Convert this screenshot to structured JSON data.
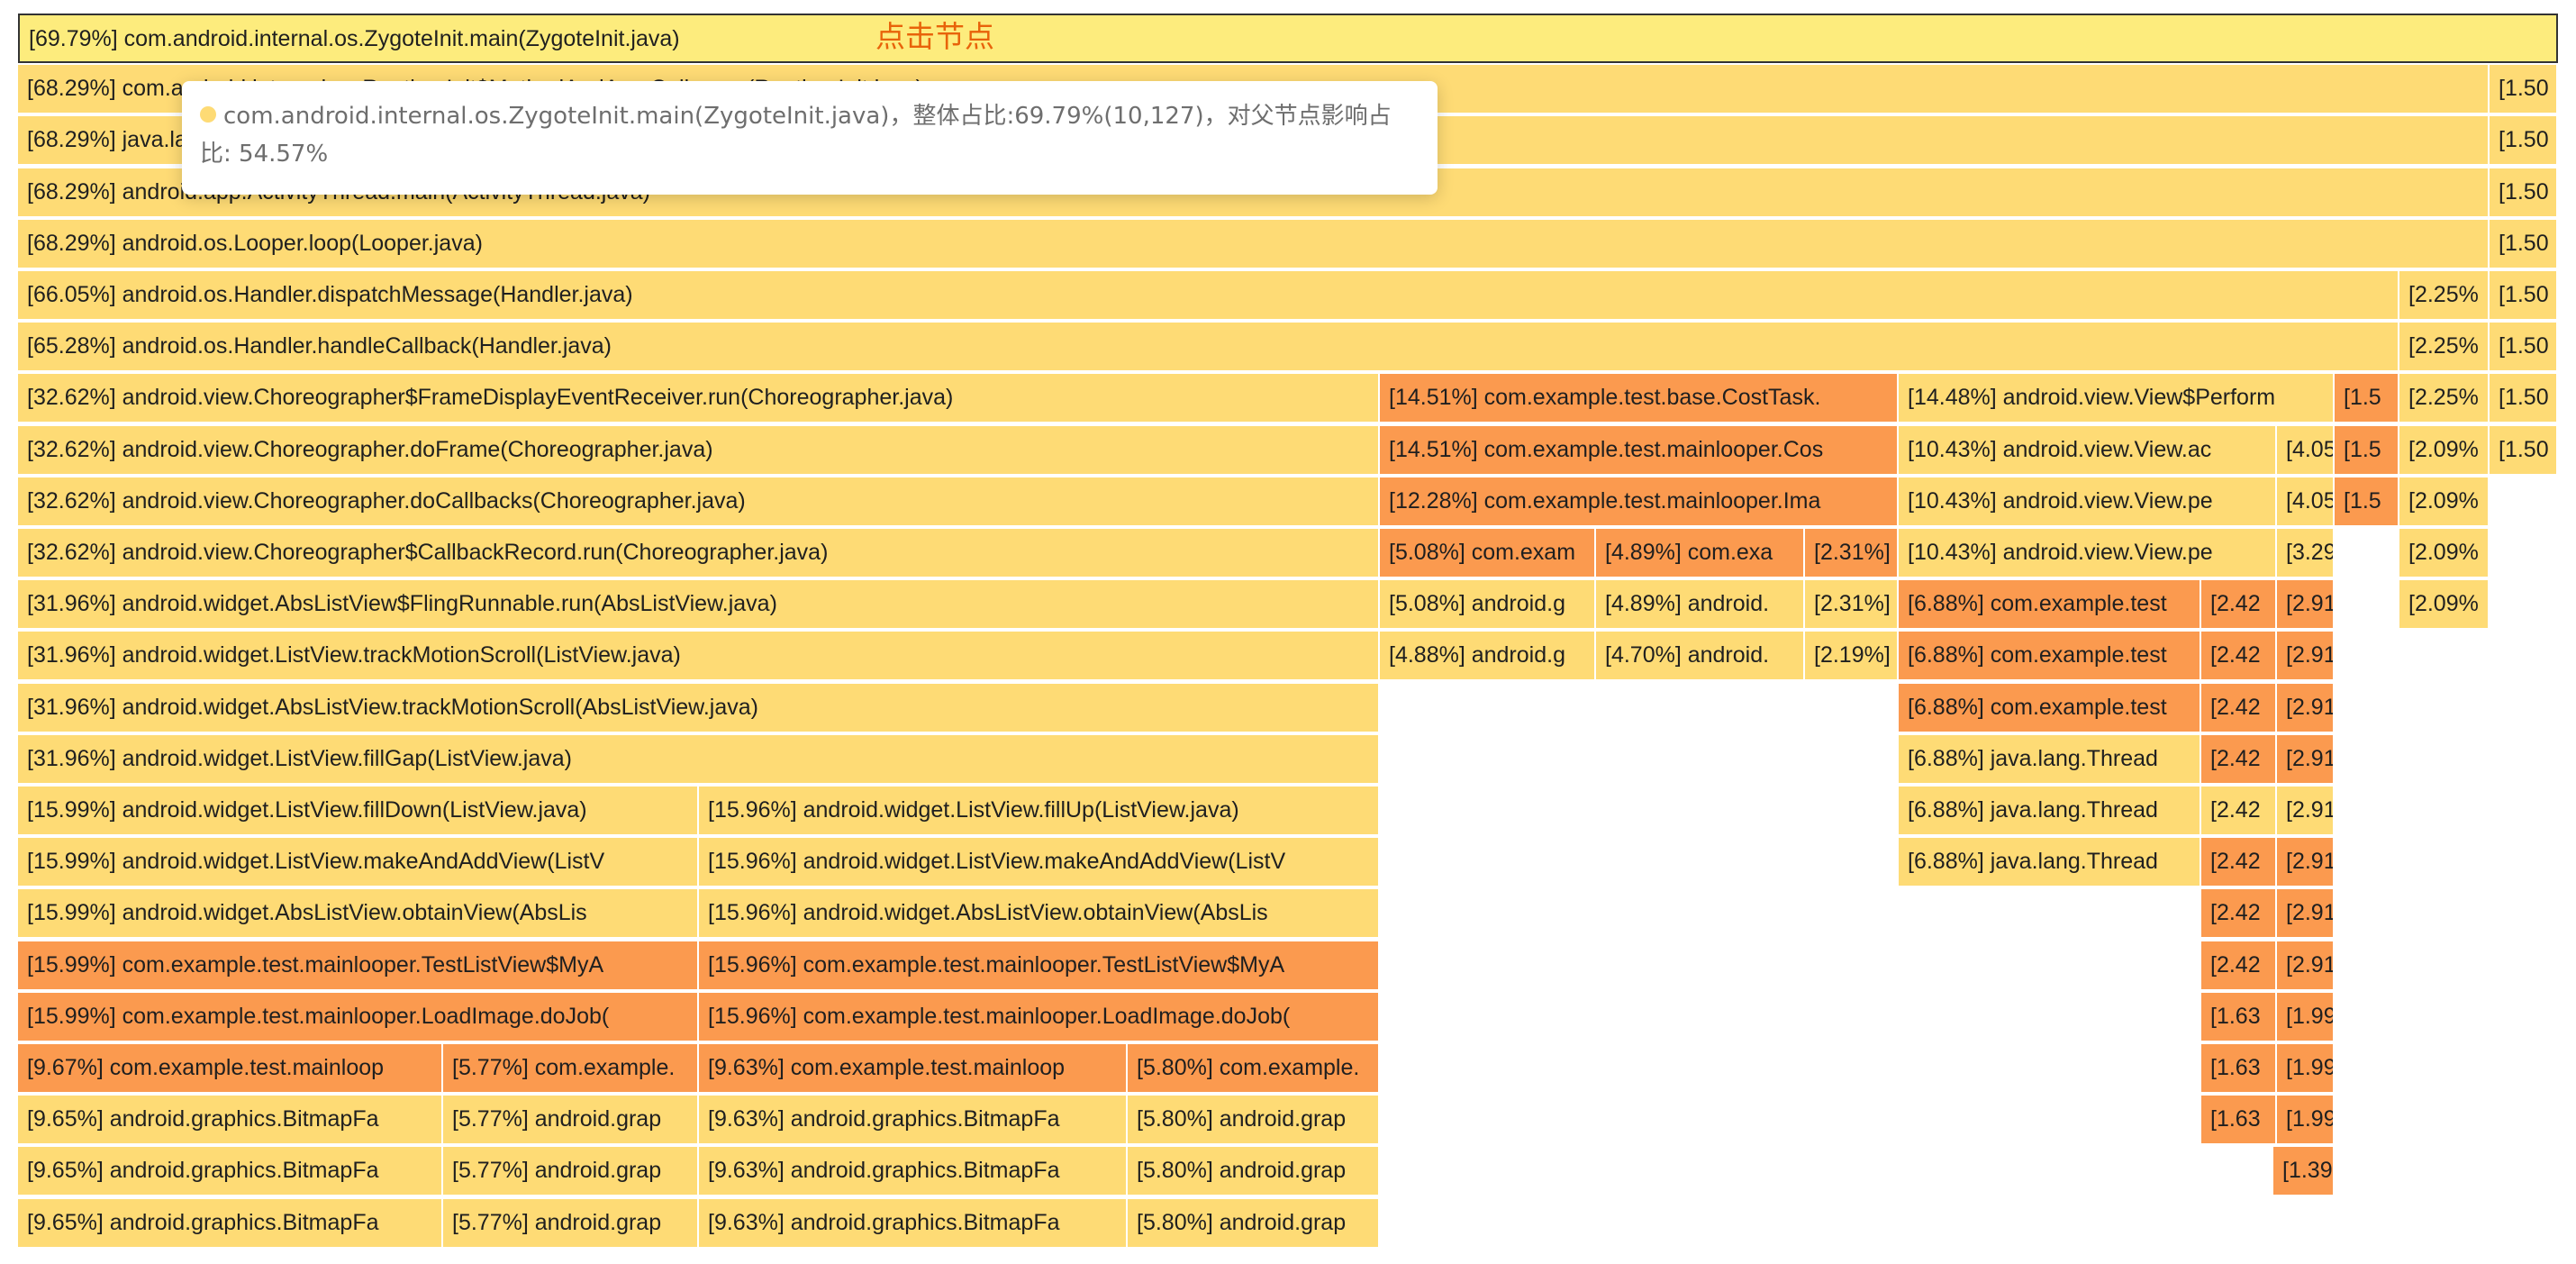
{
  "colors": {
    "root": "#fdec7d",
    "yellow": "#fedb75",
    "orange": "#fb9a4f",
    "hint": "#e8630a"
  },
  "root_hint": "点击节点",
  "tooltip": {
    "text": "com.android.internal.os.ZygoteInit.main(ZygoteInit.java)，整体占比:69.79%(10,127)，对父节点影响占比: 54.57%"
  },
  "rows": [
    [
      {
        "label": "[69.79%] com.android.internal.os.ZygoteInit.main(ZygoteInit.java)",
        "color": "root"
      }
    ],
    [
      {
        "label": "[68.29%] com.android.internal.os.RuntimeInit$MethodAndArgsCaller.run(RuntimeInit.java)",
        "color": "yellow"
      },
      {
        "label": "[1.50",
        "color": "yellow"
      }
    ],
    [
      {
        "label": "[68.29%] java.lang.reflect.Method.invoke(Native Method)",
        "color": "yellow"
      },
      {
        "label": "[1.50",
        "color": "yellow"
      }
    ],
    [
      {
        "label": "[68.29%] android.app.ActivityThread.main(ActivityThread.java)",
        "color": "yellow"
      },
      {
        "label": "[1.50",
        "color": "yellow"
      }
    ],
    [
      {
        "label": "[68.29%] android.os.Looper.loop(Looper.java)",
        "color": "yellow"
      },
      {
        "label": "[1.50",
        "color": "yellow"
      }
    ],
    [
      {
        "label": "[66.05%] android.os.Handler.dispatchMessage(Handler.java)",
        "color": "yellow"
      },
      {
        "label": "[2.25%",
        "color": "yellow"
      },
      {
        "label": "[1.50",
        "color": "yellow"
      }
    ],
    [
      {
        "label": "[65.28%] android.os.Handler.handleCallback(Handler.java)",
        "color": "yellow"
      },
      {
        "label": "[2.25%",
        "color": "yellow"
      },
      {
        "label": "[1.50",
        "color": "yellow"
      }
    ],
    [
      {
        "label": "[32.62%] android.view.Choreographer$FrameDisplayEventReceiver.run(Choreographer.java)",
        "color": "yellow"
      },
      {
        "label": "[14.51%] com.example.test.base.CostTask.",
        "color": "orange"
      },
      {
        "label": "[14.48%] android.view.View$Perform",
        "color": "yellow"
      },
      {
        "label": "[1.5",
        "color": "orange"
      },
      {
        "label": "[2.25%",
        "color": "yellow"
      },
      {
        "label": "[1.50",
        "color": "yellow"
      }
    ],
    [
      {
        "label": "[32.62%] android.view.Choreographer.doFrame(Choreographer.java)",
        "color": "yellow"
      },
      {
        "label": "[14.51%] com.example.test.mainlooper.Cos",
        "color": "orange"
      },
      {
        "label": "[10.43%] android.view.View.ac",
        "color": "yellow"
      },
      {
        "label": "[4.05",
        "color": "yellow"
      },
      {
        "label": "[1.5",
        "color": "orange"
      },
      {
        "label": "[2.09%",
        "color": "yellow"
      },
      {
        "label": "[1.50",
        "color": "yellow"
      }
    ],
    [
      {
        "label": "[32.62%] android.view.Choreographer.doCallbacks(Choreographer.java)",
        "color": "yellow"
      },
      {
        "label": "[12.28%] com.example.test.mainlooper.Ima",
        "color": "orange"
      },
      {
        "label": "[10.43%] android.view.View.pe",
        "color": "yellow"
      },
      {
        "label": "[4.05",
        "color": "yellow"
      },
      {
        "label": "[1.5",
        "color": "orange"
      },
      {
        "label": "[2.09%",
        "color": "yellow"
      }
    ],
    [
      {
        "label": "[32.62%] android.view.Choreographer$CallbackRecord.run(Choreographer.java)",
        "color": "yellow"
      },
      {
        "label": "[5.08%] com.exam",
        "color": "orange"
      },
      {
        "label": "[4.89%] com.exa",
        "color": "orange"
      },
      {
        "label": "[2.31%]",
        "color": "orange"
      },
      {
        "label": "[10.43%] android.view.View.pe",
        "color": "yellow"
      },
      {
        "label": "[3.29",
        "color": "yellow"
      },
      {
        "label": "[2.09%",
        "color": "yellow"
      }
    ],
    [
      {
        "label": "[31.96%] android.widget.AbsListView$FlingRunnable.run(AbsListView.java)",
        "color": "yellow"
      },
      {
        "label": "[5.08%] android.g",
        "color": "yellow"
      },
      {
        "label": "[4.89%] android.",
        "color": "yellow"
      },
      {
        "label": "[2.31%]",
        "color": "yellow"
      },
      {
        "label": "[6.88%] com.example.test",
        "color": "orange"
      },
      {
        "label": "[2.42",
        "color": "orange"
      },
      {
        "label": "[2.91",
        "color": "orange"
      },
      {
        "label": "[2.09%",
        "color": "yellow"
      }
    ],
    [
      {
        "label": "[31.96%] android.widget.ListView.trackMotionScroll(ListView.java)",
        "color": "yellow"
      },
      {
        "label": "[4.88%] android.g",
        "color": "yellow"
      },
      {
        "label": "[4.70%] android.",
        "color": "yellow"
      },
      {
        "label": "[2.19%]",
        "color": "yellow"
      },
      {
        "label": "[6.88%] com.example.test",
        "color": "orange"
      },
      {
        "label": "[2.42",
        "color": "orange"
      },
      {
        "label": "[2.91",
        "color": "orange"
      }
    ],
    [
      {
        "label": "[31.96%] android.widget.AbsListView.trackMotionScroll(AbsListView.java)",
        "color": "yellow"
      },
      {
        "label": "[6.88%] com.example.test",
        "color": "orange"
      },
      {
        "label": "[2.42",
        "color": "orange"
      },
      {
        "label": "[2.91",
        "color": "orange"
      }
    ],
    [
      {
        "label": "[31.96%] android.widget.ListView.fillGap(ListView.java)",
        "color": "yellow"
      },
      {
        "label": "[6.88%] java.lang.Thread",
        "color": "yellow"
      },
      {
        "label": "[2.42",
        "color": "orange"
      },
      {
        "label": "[2.91",
        "color": "orange"
      }
    ],
    [
      {
        "label": "[15.99%] android.widget.ListView.fillDown(ListView.java)",
        "color": "yellow"
      },
      {
        "label": "[15.96%] android.widget.ListView.fillUp(ListView.java)",
        "color": "yellow"
      },
      {
        "label": "[6.88%] java.lang.Thread",
        "color": "yellow"
      },
      {
        "label": "[2.42",
        "color": "yellow"
      },
      {
        "label": "[2.91",
        "color": "yellow"
      }
    ],
    [
      {
        "label": "[15.99%] android.widget.ListView.makeAndAddView(ListV",
        "color": "yellow"
      },
      {
        "label": "[15.96%] android.widget.ListView.makeAndAddView(ListV",
        "color": "yellow"
      },
      {
        "label": "[6.88%] java.lang.Thread",
        "color": "yellow"
      },
      {
        "label": "[2.42",
        "color": "orange"
      },
      {
        "label": "[2.91",
        "color": "orange"
      }
    ],
    [
      {
        "label": "[15.99%] android.widget.AbsListView.obtainView(AbsLis",
        "color": "yellow"
      },
      {
        "label": "[15.96%] android.widget.AbsListView.obtainView(AbsLis",
        "color": "yellow"
      },
      {
        "label": "[2.42",
        "color": "orange"
      },
      {
        "label": "[2.91",
        "color": "orange"
      }
    ],
    [
      {
        "label": "[15.99%] com.example.test.mainlooper.TestListView$MyA",
        "color": "orange"
      },
      {
        "label": "[15.96%] com.example.test.mainlooper.TestListView$MyA",
        "color": "orange"
      },
      {
        "label": "[2.42",
        "color": "orange"
      },
      {
        "label": "[2.91",
        "color": "orange"
      }
    ],
    [
      {
        "label": "[15.99%] com.example.test.mainlooper.LoadImage.doJob(",
        "color": "orange"
      },
      {
        "label": "[15.96%] com.example.test.mainlooper.LoadImage.doJob(",
        "color": "orange"
      },
      {
        "label": "[1.63",
        "color": "orange"
      },
      {
        "label": "[1.99",
        "color": "orange"
      }
    ],
    [
      {
        "label": "[9.67%] com.example.test.mainloop",
        "color": "orange"
      },
      {
        "label": "[5.77%] com.example.",
        "color": "orange"
      },
      {
        "label": "[9.63%] com.example.test.mainloop",
        "color": "orange"
      },
      {
        "label": "[5.80%] com.example.",
        "color": "orange"
      },
      {
        "label": "[1.63",
        "color": "orange"
      },
      {
        "label": "[1.99",
        "color": "orange"
      }
    ],
    [
      {
        "label": "[9.65%] android.graphics.BitmapFa",
        "color": "yellow"
      },
      {
        "label": "[5.77%] android.grap",
        "color": "yellow"
      },
      {
        "label": "[9.63%] android.graphics.BitmapFa",
        "color": "yellow"
      },
      {
        "label": "[5.80%] android.grap",
        "color": "yellow"
      },
      {
        "label": "[1.63",
        "color": "orange"
      },
      {
        "label": "[1.99",
        "color": "orange"
      }
    ],
    [
      {
        "label": "[9.65%] android.graphics.BitmapFa",
        "color": "yellow"
      },
      {
        "label": "[5.77%] android.grap",
        "color": "yellow"
      },
      {
        "label": "[9.63%] android.graphics.BitmapFa",
        "color": "yellow"
      },
      {
        "label": "[5.80%] android.grap",
        "color": "yellow"
      },
      {
        "label": "[1.39",
        "color": "orange"
      }
    ],
    [
      {
        "label": "[9.65%] android.graphics.BitmapFa",
        "color": "yellow"
      },
      {
        "label": "[5.77%] android.grap",
        "color": "yellow"
      },
      {
        "label": "[9.63%] android.graphics.BitmapFa",
        "color": "yellow"
      },
      {
        "label": "[5.80%] android.grap",
        "color": "yellow"
      }
    ]
  ]
}
